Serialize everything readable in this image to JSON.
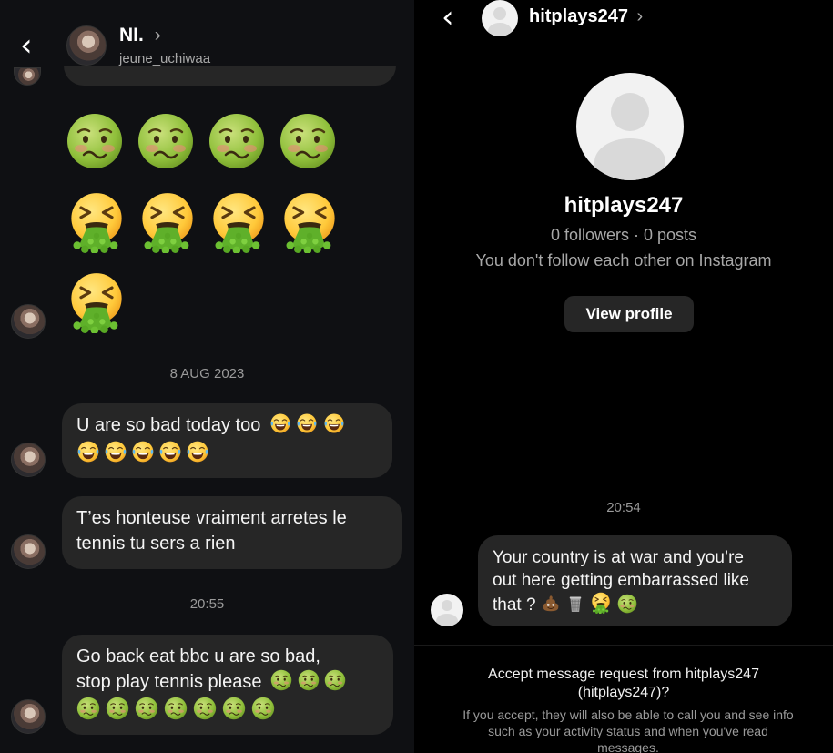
{
  "left_chat": {
    "header": {
      "name": "NI.",
      "chevron": "›",
      "username": "jeune_uchiwaa",
      "back_icon": "back-chevron-icon"
    },
    "emoji_grid": {
      "row1": [
        "nauseated-face",
        "nauseated-face",
        "nauseated-face",
        "nauseated-face"
      ],
      "row2": [
        "vomiting-face",
        "vomiting-face",
        "vomiting-face",
        "vomiting-face"
      ],
      "row3": [
        "vomiting-face"
      ]
    },
    "date_separator": "8 AUG 2023",
    "messages": [
      {
        "text": "U are so bad today too",
        "emojis_line1": [
          "joy",
          "joy",
          "joy"
        ],
        "emojis_line2": [
          "joy",
          "joy",
          "joy",
          "joy",
          "joy"
        ]
      },
      {
        "line1": "T’es honteuse vraiment arretes le",
        "line2": "tennis tu sers a rien"
      },
      {
        "line1": "Go back eat bbc u are so bad,",
        "line2": "stop play tennis please",
        "emojis_line2": [
          "nauseated",
          "nauseated",
          "nauseated"
        ],
        "emojis_line3": [
          "nauseated",
          "nauseated",
          "nauseated",
          "nauseated",
          "nauseated",
          "nauseated",
          "nauseated"
        ]
      }
    ],
    "time_separator": "20:55"
  },
  "right_chat": {
    "header": {
      "name": "hitplays247",
      "chevron": "›",
      "back_icon": "back-chevron-icon"
    },
    "profile": {
      "name": "hitplays247",
      "stats": "0 followers · 0 posts",
      "relation": "You don't follow each other on Instagram",
      "view_profile_label": "View profile"
    },
    "time_separator": "20:54",
    "message": {
      "line1": "Your country is at war and you’re",
      "line2": "out here getting embarrassed like",
      "line3": "that ?",
      "emojis": [
        "pile-of-poo",
        "wastebasket",
        "vomiting-face",
        "nauseated-face"
      ]
    },
    "request": {
      "title_line1": "Accept message request from hitplays247",
      "title_line2": "(hitplays247)?",
      "sub_line1": "If you accept, they will also be able to call you and see info",
      "sub_line2": "such as your activity status and when you've read",
      "sub_line3": "messages."
    }
  },
  "colors": {
    "left_bg": "#0f1013",
    "right_bg": "#000000",
    "bubble": "#262626",
    "muted_text": "#a8a8a8"
  }
}
